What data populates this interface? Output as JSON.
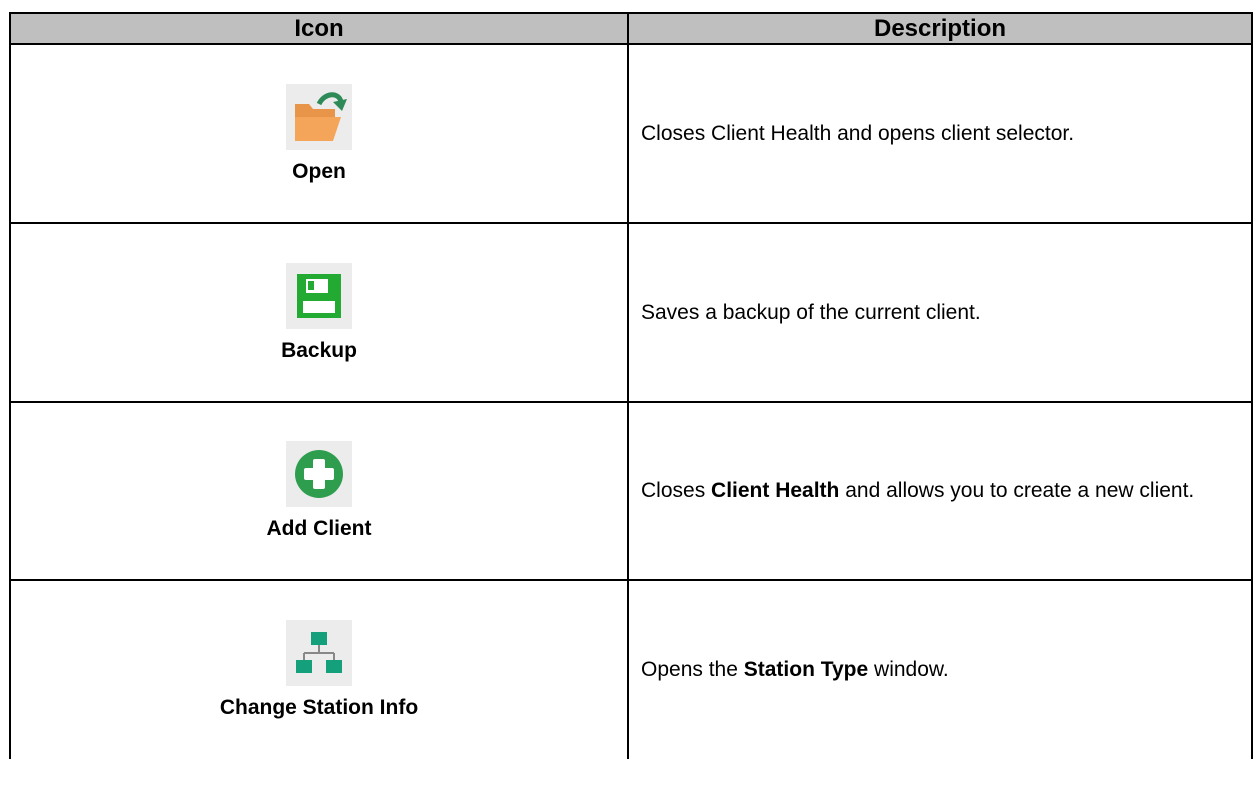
{
  "table": {
    "headers": [
      "Icon",
      "Description"
    ],
    "rows": [
      {
        "icon": "folder-open-arrow-icon",
        "label": "Open",
        "description": [
          "Closes Client Health and opens client selector."
        ]
      },
      {
        "icon": "floppy-save-icon",
        "label": "Backup",
        "description": [
          "Saves a backup of the current client."
        ]
      },
      {
        "icon": "plus-circle-icon",
        "label": "Add Client",
        "description": [
          "Closes ",
          "Client Health",
          " and allows you to create a new client."
        ]
      },
      {
        "icon": "network-hierarchy-icon",
        "label": "Change Station Info",
        "description": [
          "Opens the ",
          "Station Type",
          " window."
        ]
      }
    ]
  },
  "colors": {
    "header_bg": "#bfbfbf",
    "folder_orange": "#f0a050",
    "arrow_green": "#2e8b57",
    "save_green": "#22aa33",
    "plus_green": "#2e9e4e",
    "network_teal": "#14a07a"
  }
}
